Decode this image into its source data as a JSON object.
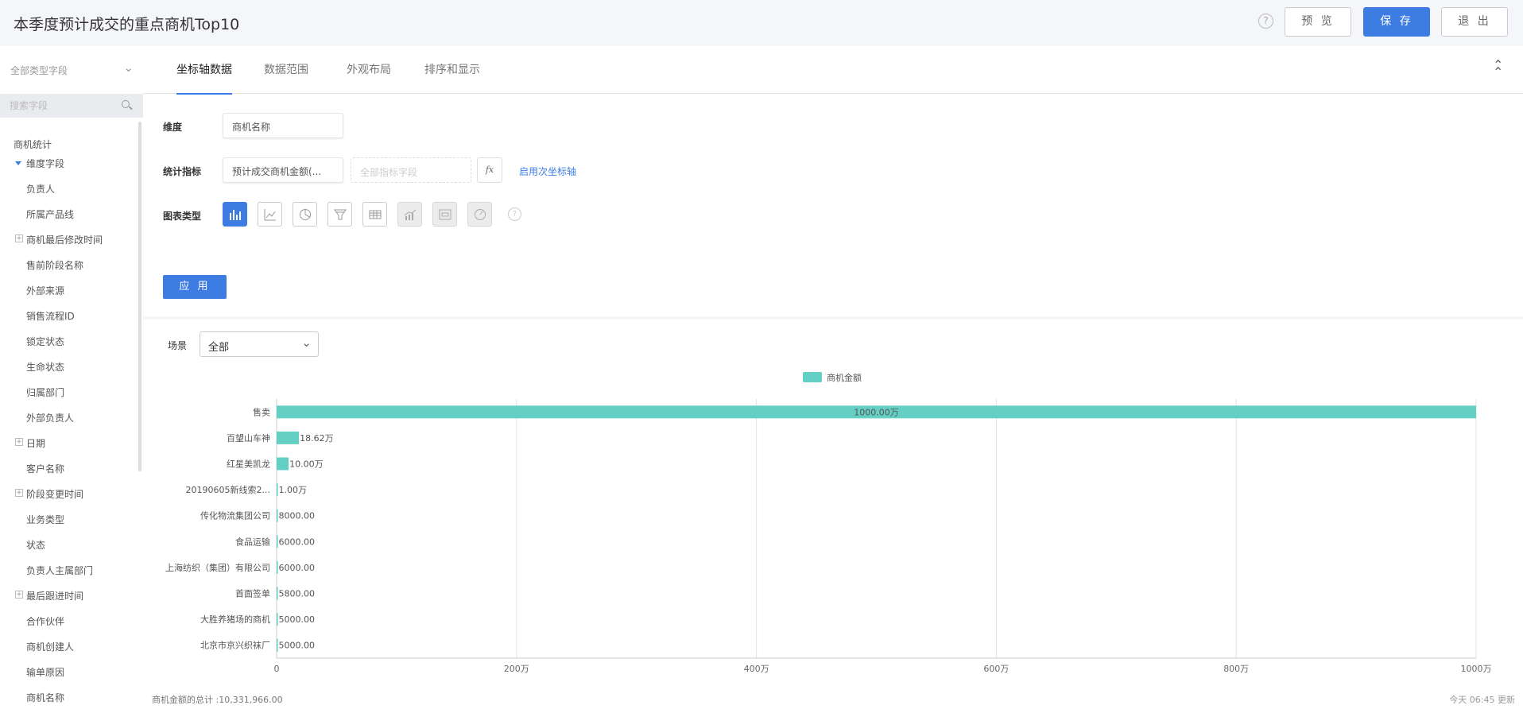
{
  "header": {
    "title": "本季度预计成交的重点商机Top10",
    "preview_label": "预 览",
    "save_label": "保 存",
    "exit_label": "退 出",
    "help_glyph": "?"
  },
  "sidebar": {
    "field_type": "全部类型字段",
    "search_placeholder": "搜索字段",
    "root": "商机统计",
    "group": "维度字段",
    "items": [
      {
        "label": "负责人",
        "kind": "leaf"
      },
      {
        "label": "所属产品线",
        "kind": "leaf"
      },
      {
        "label": "商机最后修改时间",
        "kind": "expandable"
      },
      {
        "label": "售前阶段名称",
        "kind": "leaf"
      },
      {
        "label": "外部来源",
        "kind": "leaf"
      },
      {
        "label": "销售流程ID",
        "kind": "leaf"
      },
      {
        "label": "锁定状态",
        "kind": "leaf"
      },
      {
        "label": "生命状态",
        "kind": "leaf"
      },
      {
        "label": "归属部门",
        "kind": "leaf"
      },
      {
        "label": "外部负责人",
        "kind": "leaf"
      },
      {
        "label": "日期",
        "kind": "expandable"
      },
      {
        "label": "客户名称",
        "kind": "leaf"
      },
      {
        "label": "阶段变更时间",
        "kind": "expandable"
      },
      {
        "label": "业务类型",
        "kind": "leaf"
      },
      {
        "label": "状态",
        "kind": "leaf"
      },
      {
        "label": "负责人主属部门",
        "kind": "leaf"
      },
      {
        "label": "最后跟进时间",
        "kind": "expandable"
      },
      {
        "label": "合作伙伴",
        "kind": "leaf"
      },
      {
        "label": "商机创建人",
        "kind": "leaf"
      },
      {
        "label": "输单原因",
        "kind": "leaf"
      },
      {
        "label": "商机名称",
        "kind": "leaf"
      }
    ]
  },
  "tabs": [
    "坐标轴数据",
    "数据范围",
    "外观布局",
    "排序和显示"
  ],
  "config": {
    "dimension_label": "维度",
    "dimension_value": "商机名称",
    "metric_label": "统计指标",
    "metric_value": "预计成交商机金额(...",
    "metric_placeholder": "全部指标字段",
    "fx_label": "fx",
    "secondary_axis_link": "启用次坐标轴",
    "chart_type_label": "图表类型",
    "chart_type_help": "?",
    "apply_label": "应 用"
  },
  "scene": {
    "label": "场景",
    "value": "全部"
  },
  "colors": {
    "accent": "#3d7de3",
    "bar": "#64cfc4"
  },
  "chart_data": {
    "type": "bar",
    "orientation": "horizontal",
    "categories": [
      "售卖",
      "百望山车神",
      "红星美凯龙",
      "20190605新线索2...",
      "传化物流集团公司",
      "食品运输",
      "上海纺织（集团）有限公司",
      "首面签单",
      "大胜养猪场的商机",
      "北京市京兴织袜厂"
    ],
    "series": [
      {
        "name": "商机金额",
        "values": [
          10000000,
          186200,
          100000,
          10000,
          8000,
          6000,
          6000,
          5800,
          5000,
          5000
        ],
        "labels": [
          "1000.00万",
          "18.62万",
          "10.00万",
          "1.00万",
          "8000.00",
          "6000.00",
          "6000.00",
          "5800.00",
          "5000.00",
          "5000.00"
        ]
      }
    ],
    "xlim": [
      0,
      10000000
    ],
    "xticks": [
      0,
      2000000,
      4000000,
      6000000,
      8000000,
      10000000
    ],
    "xtick_labels": [
      "0",
      "200万",
      "400万",
      "600万",
      "800万",
      "1000万"
    ],
    "grid": true,
    "legend": "top-center"
  },
  "footer": {
    "total": "商机金额的总计 :10,331,966.00",
    "updated": "今天 06:45 更新"
  }
}
